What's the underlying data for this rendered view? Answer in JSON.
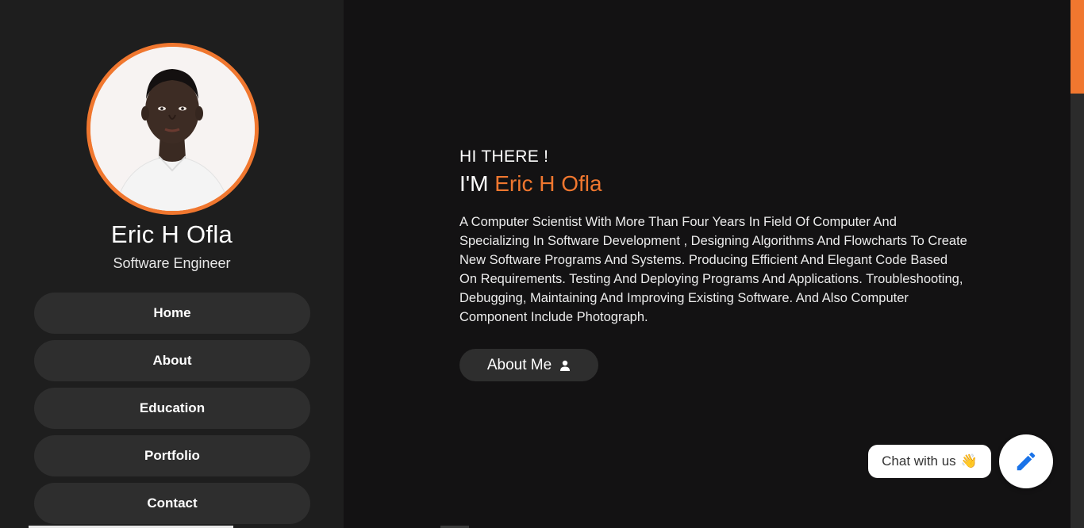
{
  "profile": {
    "name": "Eric H Ofla",
    "role": "Software Engineer",
    "avatar_icon": "profile-photo"
  },
  "nav": {
    "items": [
      {
        "label": "Home"
      },
      {
        "label": "About"
      },
      {
        "label": "Education"
      },
      {
        "label": "Portfolio"
      },
      {
        "label": "Contact"
      }
    ]
  },
  "hero": {
    "greeting": "HI THERE !",
    "intro_prefix": "I'M ",
    "intro_name": "Eric H Ofla",
    "bio": "A Computer Scientist With More Than Four Years In Field Of Computer And Specializing In Software Development , Designing Algorithms And Flowcharts To Create New Software Programs And Systems. Producing Efficient And Elegant Code Based On Requirements. Testing And Deploying Programs And Applications. Troubleshooting, Debugging, Maintaining And Improving Existing Software. And Also Computer Component Include Photograph.",
    "about_button": "About Me",
    "about_icon": "user-icon"
  },
  "chat": {
    "label": "Chat with us",
    "emoji": "👋",
    "fab_icon": "pencil-icon"
  },
  "colors": {
    "accent": "#f0772f",
    "sidebar_bg": "#1e1e1e",
    "main_bg": "#131213",
    "button_bg": "#2e2e2e",
    "fab_icon": "#1a73e8"
  }
}
